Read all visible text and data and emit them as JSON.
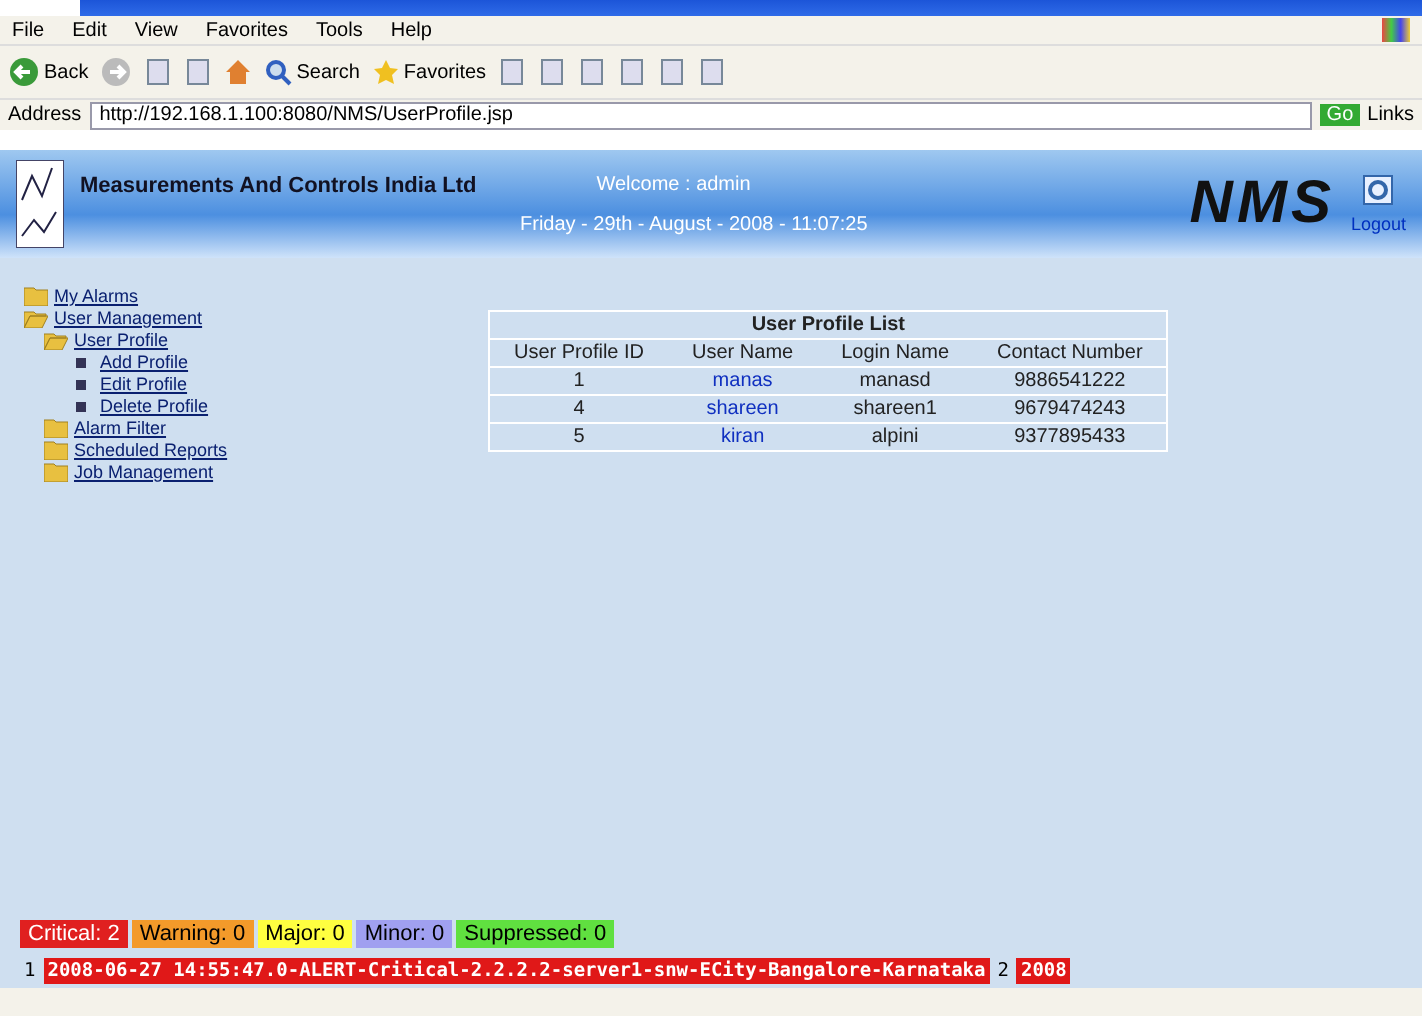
{
  "browser": {
    "menu": [
      "File",
      "Edit",
      "View",
      "Favorites",
      "Tools",
      "Help"
    ],
    "toolbar": [
      {
        "kind": "back",
        "label": "Back"
      },
      {
        "kind": "forward"
      },
      {
        "kind": "stop"
      },
      {
        "kind": "refresh"
      },
      {
        "kind": "home"
      },
      {
        "kind": "search",
        "label": "Search"
      },
      {
        "kind": "favorites",
        "label": "Favorites"
      },
      {
        "kind": "media"
      },
      {
        "kind": "history"
      },
      {
        "kind": "mail"
      },
      {
        "kind": "print"
      },
      {
        "kind": "edit"
      },
      {
        "kind": "messenger"
      }
    ],
    "address_label": "Address",
    "address": "http://192.168.1.100:8080/NMS/UserProfile.jsp",
    "go": "Go",
    "links": "Links"
  },
  "header": {
    "company": "Measurements And Controls India Ltd",
    "welcome": "Welcome : admin",
    "datetime": "Friday - 29th - August - 2008 - 11:07:25",
    "logo": "NMS",
    "logout": "Logout"
  },
  "sidebar": [
    {
      "label": "My Alarms",
      "kind": "folder"
    },
    {
      "label": "User Management",
      "kind": "open",
      "children": [
        {
          "label": "User Profile",
          "kind": "open",
          "children": [
            {
              "label": "Add Profile",
              "kind": "page"
            },
            {
              "label": "Edit Profile",
              "kind": "page"
            },
            {
              "label": "Delete Profile",
              "kind": "page"
            }
          ]
        },
        {
          "label": "Alarm Filter",
          "kind": "folder"
        },
        {
          "label": "Scheduled Reports",
          "kind": "folder"
        },
        {
          "label": "Job Management",
          "kind": "folder"
        }
      ]
    }
  ],
  "table": {
    "title": "User Profile List",
    "columns": [
      "User Profile ID",
      "User Name",
      "Login Name",
      "Contact Number"
    ],
    "rows": [
      [
        "1",
        "manas",
        "manasd",
        "9886541222"
      ],
      [
        "4",
        "shareen",
        "shareen1",
        "9679474243"
      ],
      [
        "5",
        "kiran",
        "alpini",
        "9377895433"
      ]
    ]
  },
  "alarm_counts": [
    {
      "label": "Critical: 2",
      "color": "#e02020"
    },
    {
      "label": "Warning: 0",
      "color": "#f39a2a"
    },
    {
      "label": "Major: 0",
      "color": "#ffff40"
    },
    {
      "label": "Minor: 0",
      "color": "#a0a0f0"
    },
    {
      "label": "Suppressed: 0",
      "color": "#60e040"
    }
  ],
  "ticker": [
    {
      "kind": "index",
      "text": "1"
    },
    {
      "kind": "alarm",
      "text": "2008-06-27 14:55:47.0-ALERT-Critical-2.2.2.2-server1-snw-ECity-Bangalore-Karnataka"
    },
    {
      "kind": "index",
      "text": "2"
    },
    {
      "kind": "alarm",
      "text": "2008"
    }
  ]
}
